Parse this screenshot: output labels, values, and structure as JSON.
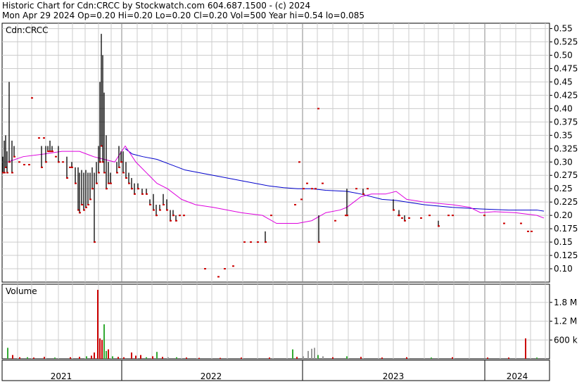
{
  "header": {
    "line1": "Historic Chart for Cdn:CRCC by Stockwatch.com 604.687.1500 - (c) 2024",
    "line2": "Mon Apr 29 2024  Op=0.20  Hi=0.20  Lo=0.20  Cl=0.20  Vol=500  Year hi=0.54  lo=0.085"
  },
  "colors": {
    "price_bar": "#000000",
    "price_dot": "#cc0000",
    "ma_short": "#dd00dd",
    "ma_long": "#0000cc",
    "vol_up": "#33aa33",
    "vol_down": "#cc0000",
    "vol_flat": "#999999",
    "grid": "#cccccc"
  },
  "chart_data": [
    {
      "type": "line",
      "title": "",
      "label": "Cdn:CRCC",
      "ylim": [
        0.075,
        0.56
      ],
      "yticks": [
        "0.55",
        "0.525",
        "0.50",
        "0.475",
        "0.45",
        "0.425",
        "0.40",
        "0.375",
        "0.35",
        "0.325",
        "0.30",
        "0.275",
        "0.25",
        "0.225",
        "0.20",
        "0.175",
        "0.15",
        "0.125",
        "0.10"
      ],
      "x_axis": [
        "2021",
        "2022",
        "2023",
        "2024"
      ],
      "grid": true,
      "price_bars": [
        {
          "t": 1,
          "hi": 0.31,
          "lo": 0.28
        },
        {
          "t": 3,
          "hi": 0.34,
          "lo": 0.28
        },
        {
          "t": 5,
          "hi": 0.35,
          "lo": 0.29
        },
        {
          "t": 7,
          "hi": 0.32,
          "lo": 0.28
        },
        {
          "t": 10,
          "hi": 0.45,
          "lo": 0.3
        },
        {
          "t": 14,
          "hi": 0.34,
          "lo": 0.28
        },
        {
          "t": 17,
          "hi": 0.33,
          "lo": 0.31
        },
        {
          "t": 56,
          "hi": 0.33,
          "lo": 0.29
        },
        {
          "t": 62,
          "hi": 0.33,
          "lo": 0.3
        },
        {
          "t": 65,
          "hi": 0.33,
          "lo": 0.32
        },
        {
          "t": 68,
          "hi": 0.34,
          "lo": 0.32
        },
        {
          "t": 71,
          "hi": 0.33,
          "lo": 0.32
        },
        {
          "t": 80,
          "hi": 0.33,
          "lo": 0.3
        },
        {
          "t": 92,
          "hi": 0.31,
          "lo": 0.27
        },
        {
          "t": 99,
          "hi": 0.3,
          "lo": 0.29
        },
        {
          "t": 104,
          "hi": 0.29,
          "lo": 0.26
        },
        {
          "t": 108,
          "hi": 0.29,
          "lo": 0.21
        },
        {
          "t": 110,
          "hi": 0.28,
          "lo": 0.205
        },
        {
          "t": 113,
          "hi": 0.285,
          "lo": 0.22
        },
        {
          "t": 116,
          "hi": 0.28,
          "lo": 0.21
        },
        {
          "t": 119,
          "hi": 0.285,
          "lo": 0.215
        },
        {
          "t": 122,
          "hi": 0.28,
          "lo": 0.22
        },
        {
          "t": 125,
          "hi": 0.28,
          "lo": 0.23
        },
        {
          "t": 128,
          "hi": 0.29,
          "lo": 0.25
        },
        {
          "t": 131,
          "hi": 0.28,
          "lo": 0.15
        },
        {
          "t": 134,
          "hi": 0.3,
          "lo": 0.26
        },
        {
          "t": 137,
          "hi": 0.33,
          "lo": 0.28
        },
        {
          "t": 139,
          "hi": 0.45,
          "lo": 0.3
        },
        {
          "t": 141,
          "hi": 0.54,
          "lo": 0.33
        },
        {
          "t": 143,
          "hi": 0.5,
          "lo": 0.3
        },
        {
          "t": 145,
          "hi": 0.43,
          "lo": 0.28
        },
        {
          "t": 148,
          "hi": 0.35,
          "lo": 0.25
        },
        {
          "t": 151,
          "hi": 0.3,
          "lo": 0.26
        },
        {
          "t": 154,
          "hi": 0.28,
          "lo": 0.26
        },
        {
          "t": 163,
          "hi": 0.3,
          "lo": 0.28
        },
        {
          "t": 166,
          "hi": 0.33,
          "lo": 0.29
        },
        {
          "t": 169,
          "hi": 0.32,
          "lo": 0.3
        },
        {
          "t": 172,
          "hi": 0.32,
          "lo": 0.28
        },
        {
          "t": 176,
          "hi": 0.3,
          "lo": 0.27
        },
        {
          "t": 180,
          "hi": 0.28,
          "lo": 0.26
        },
        {
          "t": 184,
          "hi": 0.27,
          "lo": 0.25
        },
        {
          "t": 188,
          "hi": 0.26,
          "lo": 0.24
        },
        {
          "t": 193,
          "hi": 0.26,
          "lo": 0.25
        },
        {
          "t": 199,
          "hi": 0.25,
          "lo": 0.24
        },
        {
          "t": 205,
          "hi": 0.25,
          "lo": 0.24
        },
        {
          "t": 210,
          "hi": 0.23,
          "lo": 0.22
        },
        {
          "t": 215,
          "hi": 0.24,
          "lo": 0.21
        },
        {
          "t": 219,
          "hi": 0.22,
          "lo": 0.2
        },
        {
          "t": 224,
          "hi": 0.22,
          "lo": 0.21
        },
        {
          "t": 229,
          "hi": 0.24,
          "lo": 0.22
        },
        {
          "t": 234,
          "hi": 0.23,
          "lo": 0.21
        },
        {
          "t": 239,
          "hi": 0.21,
          "lo": 0.19
        },
        {
          "t": 243,
          "hi": 0.21,
          "lo": 0.2
        },
        {
          "t": 247,
          "hi": 0.2,
          "lo": 0.19
        },
        {
          "t": 252,
          "hi": 0.2,
          "lo": 0.2
        },
        {
          "t": 258,
          "hi": 0.2,
          "lo": 0.2
        },
        {
          "t": 374,
          "hi": 0.17,
          "lo": 0.15
        },
        {
          "t": 422,
          "hi": 0.3,
          "lo": 0.3
        },
        {
          "t": 445,
          "hi": 0.25,
          "lo": 0.25
        },
        {
          "t": 450,
          "hi": 0.2,
          "lo": 0.15
        },
        {
          "t": 490,
          "hi": 0.25,
          "lo": 0.2
        },
        {
          "t": 513,
          "hi": 0.25,
          "lo": 0.24
        },
        {
          "t": 556,
          "hi": 0.23,
          "lo": 0.21
        },
        {
          "t": 564,
          "hi": 0.21,
          "lo": 0.2
        },
        {
          "t": 572,
          "hi": 0.2,
          "lo": 0.19
        },
        {
          "t": 620,
          "hi": 0.19,
          "lo": 0.18
        }
      ],
      "price_dots": [
        {
          "t": 24,
          "v": 0.3
        },
        {
          "t": 31,
          "v": 0.295
        },
        {
          "t": 38,
          "v": 0.295
        },
        {
          "t": 42,
          "v": 0.42
        },
        {
          "t": 52,
          "v": 0.345
        },
        {
          "t": 59,
          "v": 0.345
        },
        {
          "t": 76,
          "v": 0.31
        },
        {
          "t": 86,
          "v": 0.3
        },
        {
          "t": 96,
          "v": 0.29
        },
        {
          "t": 288,
          "v": 0.1
        },
        {
          "t": 307,
          "v": 0.085
        },
        {
          "t": 316,
          "v": 0.1
        },
        {
          "t": 328,
          "v": 0.105
        },
        {
          "t": 344,
          "v": 0.15
        },
        {
          "t": 353,
          "v": 0.15
        },
        {
          "t": 363,
          "v": 0.15
        },
        {
          "t": 382,
          "v": 0.2
        },
        {
          "t": 416,
          "v": 0.22
        },
        {
          "t": 425,
          "v": 0.23
        },
        {
          "t": 428,
          "v": 0.25
        },
        {
          "t": 433,
          "v": 0.26
        },
        {
          "t": 440,
          "v": 0.25
        },
        {
          "t": 449,
          "v": 0.4
        },
        {
          "t": 455,
          "v": 0.26
        },
        {
          "t": 473,
          "v": 0.19
        },
        {
          "t": 488,
          "v": 0.2
        },
        {
          "t": 503,
          "v": 0.25
        },
        {
          "t": 519,
          "v": 0.25
        },
        {
          "t": 563,
          "v": 0.2
        },
        {
          "t": 568,
          "v": 0.195
        },
        {
          "t": 578,
          "v": 0.195
        },
        {
          "t": 595,
          "v": 0.195
        },
        {
          "t": 607,
          "v": 0.2
        },
        {
          "t": 634,
          "v": 0.2
        },
        {
          "t": 640,
          "v": 0.2
        },
        {
          "t": 685,
          "v": 0.2
        },
        {
          "t": 713,
          "v": 0.185
        },
        {
          "t": 737,
          "v": 0.185
        },
        {
          "t": 747,
          "v": 0.17
        },
        {
          "t": 752,
          "v": 0.17
        }
      ],
      "ma_short": [
        [
          8,
          0.3
        ],
        [
          30,
          0.31
        ],
        [
          60,
          0.315
        ],
        [
          85,
          0.32
        ],
        [
          110,
          0.32
        ],
        [
          130,
          0.31
        ],
        [
          145,
          0.305
        ],
        [
          160,
          0.3
        ],
        [
          175,
          0.33
        ],
        [
          190,
          0.3
        ],
        [
          205,
          0.28
        ],
        [
          220,
          0.26
        ],
        [
          235,
          0.25
        ],
        [
          255,
          0.23
        ],
        [
          275,
          0.22
        ],
        [
          300,
          0.215
        ],
        [
          340,
          0.205
        ],
        [
          370,
          0.2
        ],
        [
          390,
          0.185
        ],
        [
          420,
          0.185
        ],
        [
          440,
          0.19
        ],
        [
          460,
          0.205
        ],
        [
          480,
          0.21
        ],
        [
          490,
          0.215
        ],
        [
          500,
          0.225
        ],
        [
          510,
          0.235
        ],
        [
          525,
          0.24
        ],
        [
          545,
          0.24
        ],
        [
          560,
          0.245
        ],
        [
          575,
          0.23
        ],
        [
          600,
          0.225
        ],
        [
          640,
          0.22
        ],
        [
          665,
          0.215
        ],
        [
          680,
          0.205
        ],
        [
          700,
          0.207
        ],
        [
          730,
          0.205
        ],
        [
          760,
          0.2
        ],
        [
          770,
          0.195
        ]
      ],
      "ma_long": [
        [
          175,
          0.325
        ],
        [
          185,
          0.315
        ],
        [
          200,
          0.31
        ],
        [
          220,
          0.305
        ],
        [
          240,
          0.295
        ],
        [
          260,
          0.285
        ],
        [
          300,
          0.275
        ],
        [
          340,
          0.265
        ],
        [
          380,
          0.255
        ],
        [
          400,
          0.252
        ],
        [
          420,
          0.25
        ],
        [
          440,
          0.25
        ],
        [
          460,
          0.247
        ],
        [
          490,
          0.245
        ],
        [
          510,
          0.24
        ],
        [
          540,
          0.23
        ],
        [
          560,
          0.228
        ],
        [
          600,
          0.22
        ],
        [
          640,
          0.215
        ],
        [
          680,
          0.212
        ],
        [
          720,
          0.21
        ],
        [
          760,
          0.21
        ],
        [
          770,
          0.208
        ]
      ]
    },
    {
      "type": "bar",
      "title": "",
      "label": "Volume",
      "ylim": [
        0,
        2.2
      ],
      "yticks": [
        "1.8 M",
        "1.2 M",
        "600 k"
      ],
      "ytick_values": [
        1.8,
        1.2,
        0.6
      ],
      "volume_bars": [
        {
          "t": 8,
          "v": 0.35,
          "c": "up"
        },
        {
          "t": 15,
          "v": 0.12,
          "c": "down"
        },
        {
          "t": 25,
          "v": 0.05,
          "c": "down"
        },
        {
          "t": 36,
          "v": 0.05,
          "c": "up"
        },
        {
          "t": 45,
          "v": 0.04,
          "c": "down"
        },
        {
          "t": 60,
          "v": 0.06,
          "c": "down"
        },
        {
          "t": 75,
          "v": 0.04,
          "c": "up"
        },
        {
          "t": 97,
          "v": 0.05,
          "c": "down"
        },
        {
          "t": 110,
          "v": 0.06,
          "c": "down"
        },
        {
          "t": 120,
          "v": 0.08,
          "c": "up"
        },
        {
          "t": 127,
          "v": 0.1,
          "c": "down"
        },
        {
          "t": 131,
          "v": 0.2,
          "c": "down"
        },
        {
          "t": 136,
          "v": 2.2,
          "c": "down"
        },
        {
          "t": 139,
          "v": 0.65,
          "c": "down"
        },
        {
          "t": 142,
          "v": 0.6,
          "c": "down"
        },
        {
          "t": 145,
          "v": 1.1,
          "c": "up"
        },
        {
          "t": 148,
          "v": 0.25,
          "c": "up"
        },
        {
          "t": 151,
          "v": 0.3,
          "c": "down"
        },
        {
          "t": 157,
          "v": 0.08,
          "c": "up"
        },
        {
          "t": 165,
          "v": 0.06,
          "c": "down"
        },
        {
          "t": 173,
          "v": 0.05,
          "c": "down"
        },
        {
          "t": 184,
          "v": 0.2,
          "c": "down"
        },
        {
          "t": 190,
          "v": 0.1,
          "c": "down"
        },
        {
          "t": 197,
          "v": 0.12,
          "c": "down"
        },
        {
          "t": 205,
          "v": 0.05,
          "c": "up"
        },
        {
          "t": 214,
          "v": 0.08,
          "c": "down"
        },
        {
          "t": 220,
          "v": 0.22,
          "c": "up"
        },
        {
          "t": 228,
          "v": 0.06,
          "c": "down"
        },
        {
          "t": 236,
          "v": 0.05,
          "c": "flat"
        },
        {
          "t": 248,
          "v": 0.05,
          "c": "up"
        },
        {
          "t": 262,
          "v": 0.04,
          "c": "down"
        },
        {
          "t": 280,
          "v": 0.03,
          "c": "down"
        },
        {
          "t": 310,
          "v": 0.03,
          "c": "down"
        },
        {
          "t": 340,
          "v": 0.04,
          "c": "down"
        },
        {
          "t": 380,
          "v": 0.04,
          "c": "down"
        },
        {
          "t": 413,
          "v": 0.3,
          "c": "up"
        },
        {
          "t": 419,
          "v": 0.06,
          "c": "down"
        },
        {
          "t": 428,
          "v": 0.08,
          "c": "flat"
        },
        {
          "t": 435,
          "v": 0.25,
          "c": "flat"
        },
        {
          "t": 440,
          "v": 0.32,
          "c": "flat"
        },
        {
          "t": 444,
          "v": 0.35,
          "c": "flat"
        },
        {
          "t": 449,
          "v": 0.12,
          "c": "up"
        },
        {
          "t": 456,
          "v": 0.08,
          "c": "flat"
        },
        {
          "t": 470,
          "v": 0.05,
          "c": "down"
        },
        {
          "t": 490,
          "v": 0.08,
          "c": "up"
        },
        {
          "t": 510,
          "v": 0.06,
          "c": "down"
        },
        {
          "t": 540,
          "v": 0.04,
          "c": "down"
        },
        {
          "t": 575,
          "v": 0.05,
          "c": "down"
        },
        {
          "t": 610,
          "v": 0.04,
          "c": "up"
        },
        {
          "t": 640,
          "v": 0.05,
          "c": "down"
        },
        {
          "t": 690,
          "v": 0.04,
          "c": "down"
        },
        {
          "t": 720,
          "v": 0.04,
          "c": "down"
        },
        {
          "t": 744,
          "v": 0.65,
          "c": "down"
        },
        {
          "t": 760,
          "v": 0.04,
          "c": "up"
        }
      ]
    }
  ],
  "time_axis": {
    "labels": [
      {
        "text": "2021",
        "t": 84
      },
      {
        "text": "2022",
        "t": 297
      },
      {
        "text": "2023",
        "t": 556
      },
      {
        "text": "2024",
        "t": 732
      }
    ],
    "year_boundaries": [
      170,
      427,
      686
    ],
    "month_gridlines": [
      22,
      42,
      62,
      80,
      100,
      118,
      137,
      155,
      170,
      192,
      213,
      235,
      255,
      277,
      298,
      320,
      342,
      363,
      385,
      405,
      427,
      448,
      470,
      492,
      513,
      535,
      556,
      578,
      600,
      620,
      642,
      664,
      686,
      708,
      730,
      751,
      772
    ]
  }
}
